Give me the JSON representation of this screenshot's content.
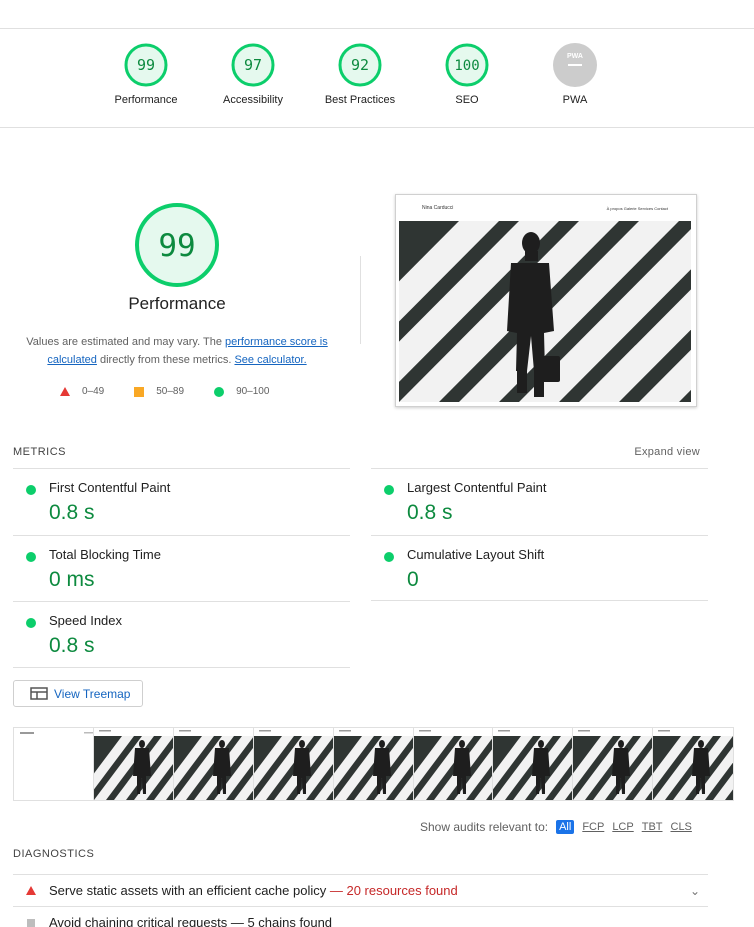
{
  "categories": [
    {
      "label": "Performance",
      "score": "99",
      "color": "#0cce6b"
    },
    {
      "label": "Accessibility",
      "score": "97",
      "color": "#0cce6b"
    },
    {
      "label": "Best Practices",
      "score": "92",
      "color": "#0cce6b"
    },
    {
      "label": "SEO",
      "score": "100",
      "color": "#0cce6b"
    },
    {
      "label": "PWA",
      "score": "PWA",
      "color": "#cccccc"
    }
  ],
  "main": {
    "score": "99",
    "title": "Performance",
    "desc_prefix": "Values are estimated and may vary. The ",
    "desc_link1": "performance score is calculated",
    "desc_middle": " directly from these metrics. ",
    "desc_link2": "See calculator.",
    "legend": [
      {
        "icon": "triangle",
        "range": "0–49"
      },
      {
        "icon": "square",
        "range": "50–89"
      },
      {
        "icon": "circle",
        "range": "90–100"
      }
    ]
  },
  "screenshot": {
    "brand": "Nina Carducci",
    "nav": "À propos   Galerie   Services   Contact"
  },
  "metrics": {
    "title": "METRICS",
    "expand": "Expand view",
    "items": [
      {
        "name": "First Contentful Paint",
        "value": "0.8 s"
      },
      {
        "name": "Largest Contentful Paint",
        "value": "0.8 s"
      },
      {
        "name": "Total Blocking Time",
        "value": "0 ms"
      },
      {
        "name": "Cumulative Layout Shift",
        "value": "0"
      },
      {
        "name": "Speed Index",
        "value": "0.8 s"
      }
    ]
  },
  "treemap_label": "View Treemap",
  "filters": {
    "label": "Show audits relevant to:",
    "chips": [
      "All",
      "FCP",
      "LCP",
      "TBT",
      "CLS"
    ]
  },
  "diagnostics": {
    "title": "DIAGNOSTICS",
    "audit1_text": "Serve static assets with an efficient cache policy",
    "audit1_detail": " — 20 resources found",
    "audit2_text": "Avoid chaining critical requests — 5 chains found"
  }
}
